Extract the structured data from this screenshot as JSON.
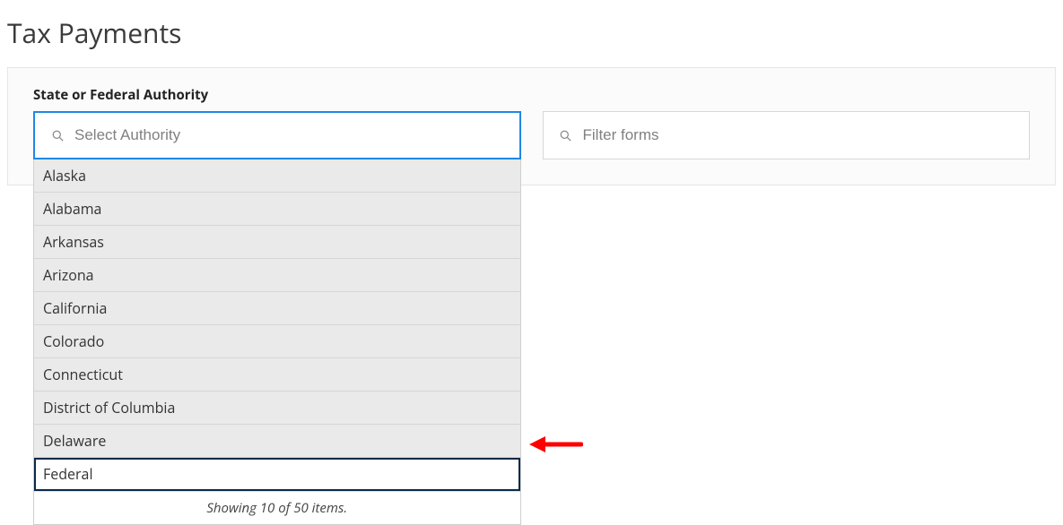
{
  "page": {
    "title": "Tax Payments"
  },
  "panel": {
    "authority": {
      "label": "State or Federal Authority",
      "placeholder": "Select Authority",
      "dropdown": {
        "items": [
          {
            "label": "Alaska",
            "highlight": false
          },
          {
            "label": "Alabama",
            "highlight": false
          },
          {
            "label": "Arkansas",
            "highlight": false
          },
          {
            "label": "Arizona",
            "highlight": false
          },
          {
            "label": "California",
            "highlight": false
          },
          {
            "label": "Colorado",
            "highlight": false
          },
          {
            "label": "Connecticut",
            "highlight": false
          },
          {
            "label": "District of Columbia",
            "highlight": false
          },
          {
            "label": "Delaware",
            "highlight": false
          },
          {
            "label": "Federal",
            "highlight": true
          }
        ],
        "footer": "Showing 10 of 50 items."
      }
    },
    "forms_filter": {
      "placeholder": "Filter forms"
    }
  },
  "annotation": {
    "arrow_color": "#ff0000"
  }
}
